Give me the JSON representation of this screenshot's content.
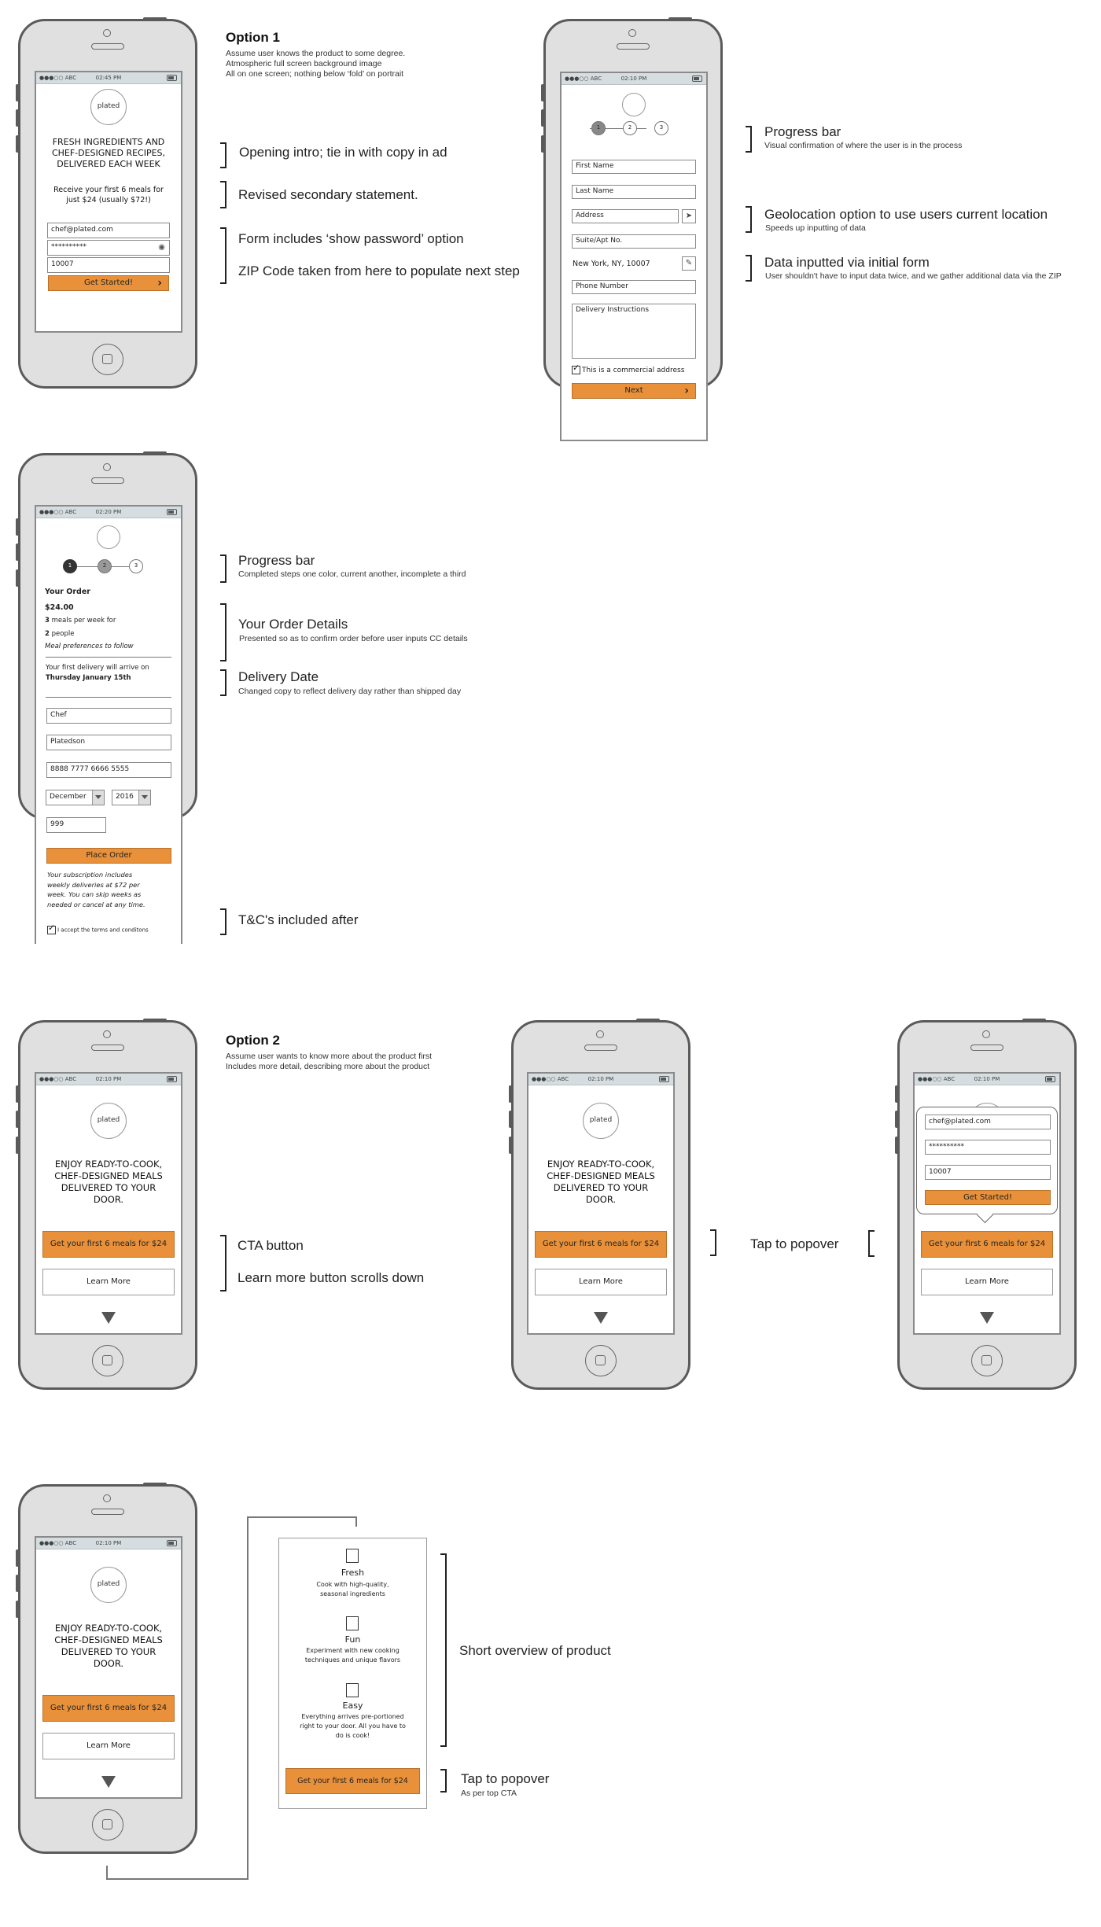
{
  "status_bar": {
    "carrier": "●●●○○ ABC",
    "battery_icon": "battery-icon"
  },
  "option1": {
    "title": "Option 1",
    "notes": [
      "Assume user knows the product to some degree.",
      "Atmospheric full screen background image",
      "All on one screen; nothing below ‘fold’ on portrait"
    ],
    "screen": {
      "time": "02:45 PM",
      "logo": "plated",
      "headline": [
        "FRESH INGREDIENTS AND",
        "CHEF-DESIGNED RECIPES,",
        "DELIVERED EACH WEEK"
      ],
      "subline": [
        "Receive your first 6 meals for",
        "just $24 (usually $72!)"
      ],
      "email": "chef@plated.com",
      "password": "**********",
      "zip": "10007",
      "cta": "Get Started!"
    },
    "annotations": [
      {
        "title": "Opening intro; tie in with copy in ad"
      },
      {
        "title": "Revised secondary statement."
      },
      {
        "title": "Form includes ‘show password’ option",
        "title2": "ZIP Code taken from here to populate next step"
      }
    ]
  },
  "step1": {
    "screen": {
      "time": "02:10 PM",
      "steps": [
        "1",
        "2",
        "3"
      ],
      "first_name": "First Name",
      "last_name": "Last Name",
      "address": "Address",
      "suite": "Suite/Apt No.",
      "city_line": "New York, NY, 10007",
      "phone": "Phone Number",
      "delivery": "Delivery Instructions",
      "commercial": "This is a commercial address",
      "next": "Next"
    },
    "annotations": [
      {
        "title": "Progress bar",
        "sub": "Visual confirmation of where the user is in the process"
      },
      {
        "title": "Geolocation option to use users current location",
        "sub": "Speeds up inputting of data"
      },
      {
        "title": "Data inputted via initial form",
        "sub": "User shouldn't have to input data twice, and we gather additional data via the ZIP"
      }
    ]
  },
  "step2": {
    "screen": {
      "time": "02:20 PM",
      "steps": [
        "1",
        "2",
        "3"
      ],
      "order_title": "Your Order",
      "price": "$24.00",
      "meals_num": "3",
      "meals_text": "meals per week for",
      "people_num": "2",
      "people_text": "people",
      "prefs": "Meal preferences to follow",
      "delivery_line1": "Your first delivery will arrive on",
      "delivery_line2": "Thursday January 15th",
      "first_name": "Chef",
      "last_name": "Platedson",
      "card": "8888 7777 6666 5555",
      "month": "December",
      "year": "2016",
      "cvv": "999",
      "place_order": "Place Order",
      "subscription": [
        "Your subscription includes",
        "weekly deliveries at $72 per",
        "week. You can skip weeks as",
        "needed or cancel at any time."
      ],
      "terms": "I accept the terms and conditons"
    },
    "annotations": [
      {
        "title": "Progress bar",
        "sub": "Completed steps one color, current another, incomplete a third"
      },
      {
        "title": "Your Order Details",
        "sub": "Presented so as to confirm order before user inputs CC details"
      },
      {
        "title": "Delivery Date",
        "sub": "Changed copy to reflect delivery day rather than shipped day"
      },
      {
        "title": "T&C's included after"
      }
    ]
  },
  "option2": {
    "title": "Option 2",
    "notes": [
      "Assume user wants to know more about the product first",
      "Includes more detail, describing more about the product"
    ],
    "screen": {
      "time": "02:10 PM",
      "logo": "plated",
      "headline": [
        "ENJOY READY-TO-COOK,",
        "CHEF-DESIGNED MEALS",
        "DELIVERED TO YOUR",
        "DOOR."
      ],
      "cta": "Get your first 6 meals for $24",
      "learn_more": "Learn More"
    },
    "popover": {
      "email": "chef@plated.com",
      "password": "**********",
      "zip": "10007",
      "cta": "Get Started!"
    },
    "annotations": [
      {
        "title": "CTA button",
        "title2": "Learn more button scrolls down"
      },
      {
        "title": "Tap to popover"
      }
    ]
  },
  "overview": {
    "features": [
      {
        "title": "Fresh",
        "desc": [
          "Cook with high-quality,",
          "seasonal ingredients"
        ]
      },
      {
        "title": "Fun",
        "desc": [
          "Experiment with new cooking",
          "techniques and unique flavors"
        ]
      },
      {
        "title": "Easy",
        "desc": [
          "Everything arrives pre-portioned",
          "right to your door. All you have to",
          "do is cook!"
        ]
      }
    ],
    "cta": "Get your first 6 meals for $24",
    "annotations": [
      {
        "title": "Short overview of product"
      },
      {
        "title": "Tap to popover",
        "sub": "As per top CTA"
      }
    ]
  },
  "colors": {
    "accent": "#e8913a",
    "status_bar": "#d5dde1",
    "phone_body": "#e0e0e0",
    "step_complete": "#333333",
    "step_current": "#999999"
  }
}
